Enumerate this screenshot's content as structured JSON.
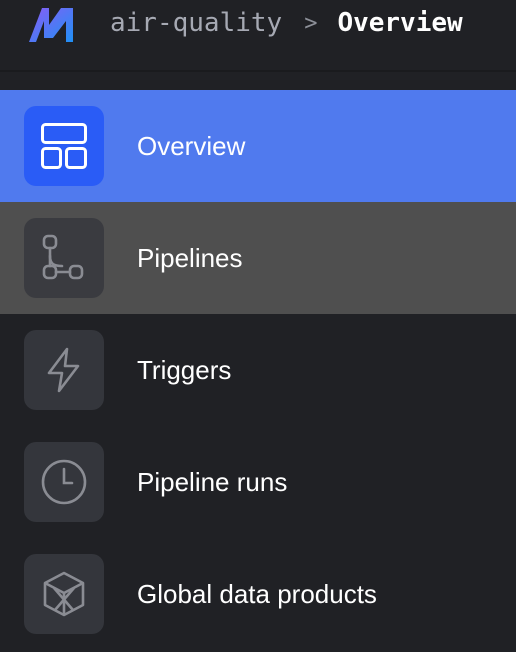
{
  "header": {
    "logo": "mage-logo",
    "breadcrumb": {
      "project": "air-quality",
      "separator": ">",
      "current": "Overview"
    }
  },
  "nav": {
    "items": [
      {
        "label": "Overview",
        "icon": "layout-icon",
        "state": "active"
      },
      {
        "label": "Pipelines",
        "icon": "pipeline-icon",
        "state": "hover"
      },
      {
        "label": "Triggers",
        "icon": "lightning-icon",
        "state": "default"
      },
      {
        "label": "Pipeline runs",
        "icon": "clock-icon",
        "state": "default"
      },
      {
        "label": "Global data products",
        "icon": "cube-icon",
        "state": "default"
      }
    ]
  },
  "colors": {
    "background": "#202125",
    "active_row": "#507aee",
    "active_icon_bg": "#2a5cf6",
    "hover_row": "#4f4f4f",
    "icon_bg": "#34363c",
    "icon_stroke": "#8a8c93",
    "logo_gradient": [
      "#7c55f4",
      "#2b8bf6"
    ]
  }
}
